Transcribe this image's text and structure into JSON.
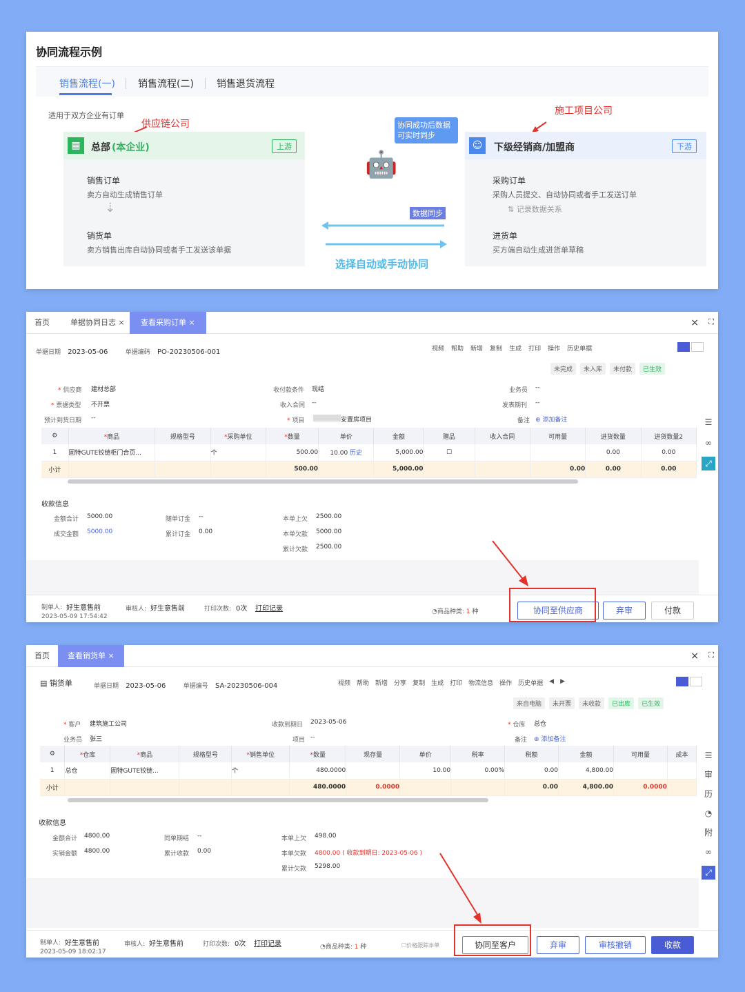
{
  "p1": {
    "title": "协同流程示例",
    "tabs": [
      "销售流程(一)",
      "销售流程(二)",
      "销售退货流程"
    ],
    "note": "适用于双方企业有订单",
    "supplier_label": "供应链公司",
    "proj_label": "施工项目公司",
    "left": {
      "title_a": "总部",
      "title_b": "(本企业)",
      "tag": "上游",
      "b1": "销售订单",
      "b1s": "卖方自动生成销售订单",
      "b2": "销货单",
      "b2s": "卖方销售出库自动协同或者手工发送该单据"
    },
    "right": {
      "title": "下级经销商/加盟商",
      "tag": "下游",
      "b1": "采购订单",
      "b1s": "采购人员提交、自动协同或者手工发送订单",
      "mid": "记录数据关系",
      "b2": "进货单",
      "b2s": "买方端自动生成进货单草稿"
    },
    "bubble": "协同成功后数据可实时同步",
    "sync": "数据同步",
    "choose": "选择自动或手动协同"
  },
  "p2": {
    "tabs": [
      "首页",
      "单据协同日志",
      "查看采购订单"
    ],
    "date_label": "单据日期",
    "date": "2023-05-06",
    "no_label": "单据编码",
    "no": "PO-20230506-001",
    "toolbar": [
      "视频",
      "帮助",
      "新增",
      "复制",
      "生成",
      "打印",
      "操作",
      "历史单据"
    ],
    "status": [
      "未完成",
      "未入库",
      "未付款",
      "已生效"
    ],
    "fields": {
      "supplier_l": "供应商",
      "supplier": "建材总部",
      "pay_l": "收付款条件",
      "pay": "现结",
      "sales_l": "业务员",
      "sales": "--",
      "inv_l": "票据类型",
      "inv": "不开票",
      "contract_l": "收入合同",
      "contract": "--",
      "invdate_l": "发表期刊",
      "invdate": "--",
      "arrive_l": "预计到货日期",
      "arrive": "--",
      "proj_l": "项目",
      "proj": "安置房项目",
      "memo_l": "备注",
      "memo": "添加备注"
    },
    "cols": [
      "商品",
      "规格型号",
      "采购单位",
      "数量",
      "单价",
      "金额",
      "赠品",
      "收入合同",
      "可用量",
      "进货数量",
      "进货数量2"
    ],
    "row": [
      "1",
      "固特GUTE铰链柜门合页...",
      "",
      "个",
      "500.00",
      "10.00",
      "历史",
      "5,000.00",
      "",
      "",
      "",
      "0.00",
      "0.00"
    ],
    "sum": {
      "label": "小计",
      "qty": "500.00",
      "amt": "5,000.00",
      "a": "0.00",
      "b": "0.00",
      "c": "0.00"
    },
    "pay_title": "收款信息",
    "pay": {
      "total_l": "金额合计",
      "total": "5000.00",
      "deal_l": "成交金额",
      "deal": "5000.00",
      "order_l": "随单订金",
      "order": "--",
      "acc_l": "累计订金",
      "acc": "0.00",
      "prev_l": "本单上欠",
      "prev": "2500.00",
      "owe_l": "本单欠款",
      "owe": "5000.00",
      "sum_l": "累计欠款",
      "sum": "2500.00"
    },
    "footer": {
      "maker_l": "制单人:",
      "maker": "好生意售前",
      "time": "2023-05-09 17:54:42",
      "audit_l": "审核人:",
      "audit": "好生意售前",
      "print_l": "打印次数:",
      "print": "0次",
      "print_rec": "打印记录",
      "kind_l": "商品种类:",
      "kind": "1",
      "kind_u": "种"
    },
    "buttons": [
      "协同至供应商",
      "弃审",
      "付款"
    ]
  },
  "p3": {
    "tabs": [
      "首页",
      "查看销货单"
    ],
    "doc": "销货单",
    "date_label": "单据日期",
    "date": "2023-05-06",
    "no_label": "单据编号",
    "no": "SA-20230506-004",
    "toolbar": [
      "视频",
      "帮助",
      "新增",
      "分享",
      "复制",
      "生成",
      "打印",
      "物流信息",
      "操作",
      "历史单据"
    ],
    "status": [
      "来自电脑",
      "未开票",
      "未收款",
      "已出库",
      "已生效"
    ],
    "fields": {
      "cust_l": "客户",
      "cust": "建筑施工公司",
      "due_l": "收款到期日",
      "due": "2023-05-06",
      "wh_l": "仓库",
      "wh": "总仓",
      "sales_l": "业务员",
      "sales": "张三",
      "proj_l": "项目",
      "proj": "--",
      "memo_l": "备注",
      "memo": "添加备注"
    },
    "cols": [
      "仓库",
      "商品",
      "规格型号",
      "销售单位",
      "数量",
      "现存量",
      "单价",
      "税率",
      "税额",
      "金额",
      "可用量",
      "成本"
    ],
    "row": [
      "1",
      "总仓",
      "固特GUTE铰链...",
      "",
      "个",
      "480.0000",
      "",
      "10.00",
      "0.00%",
      "0.00",
      "4,800.00",
      "",
      ""
    ],
    "sum": {
      "label": "小计",
      "qty": "480.0000",
      "stock": "0.0000",
      "tax": "0.00",
      "amt": "4,800.00",
      "avail": "0.0000"
    },
    "pay_title": "收款信息",
    "pay": {
      "total_l": "金额合计",
      "total": "4800.00",
      "real_l": "实销金额",
      "real": "4800.00",
      "same_l": "同单期结",
      "same": "--",
      "acc_l": "累计收款",
      "acc": "0.00",
      "prev_l": "本单上欠",
      "prev": "498.00",
      "owe_l": "本单欠款",
      "owe": "4800.00",
      "owe_note": "( 收款到期日: 2023-05-06 )",
      "sum_l": "累计欠款",
      "sum": "5298.00"
    },
    "footer": {
      "maker_l": "制单人:",
      "maker": "好生意售前",
      "time": "2023-05-09 18:02:17",
      "audit_l": "审核人:",
      "audit": "好生意售前",
      "print_l": "打印次数:",
      "print": "0次",
      "print_rec": "打印记录",
      "kind_l": "商品种类:",
      "kind": "1",
      "kind_u": "种",
      "price_note": "价格跟踪本单"
    },
    "buttons": [
      "协同至客户",
      "弃审",
      "审核撤销",
      "收款"
    ]
  },
  "colors": {
    "accent": "#4a5bd6",
    "green": "#2db55d",
    "red": "#e2322b"
  }
}
